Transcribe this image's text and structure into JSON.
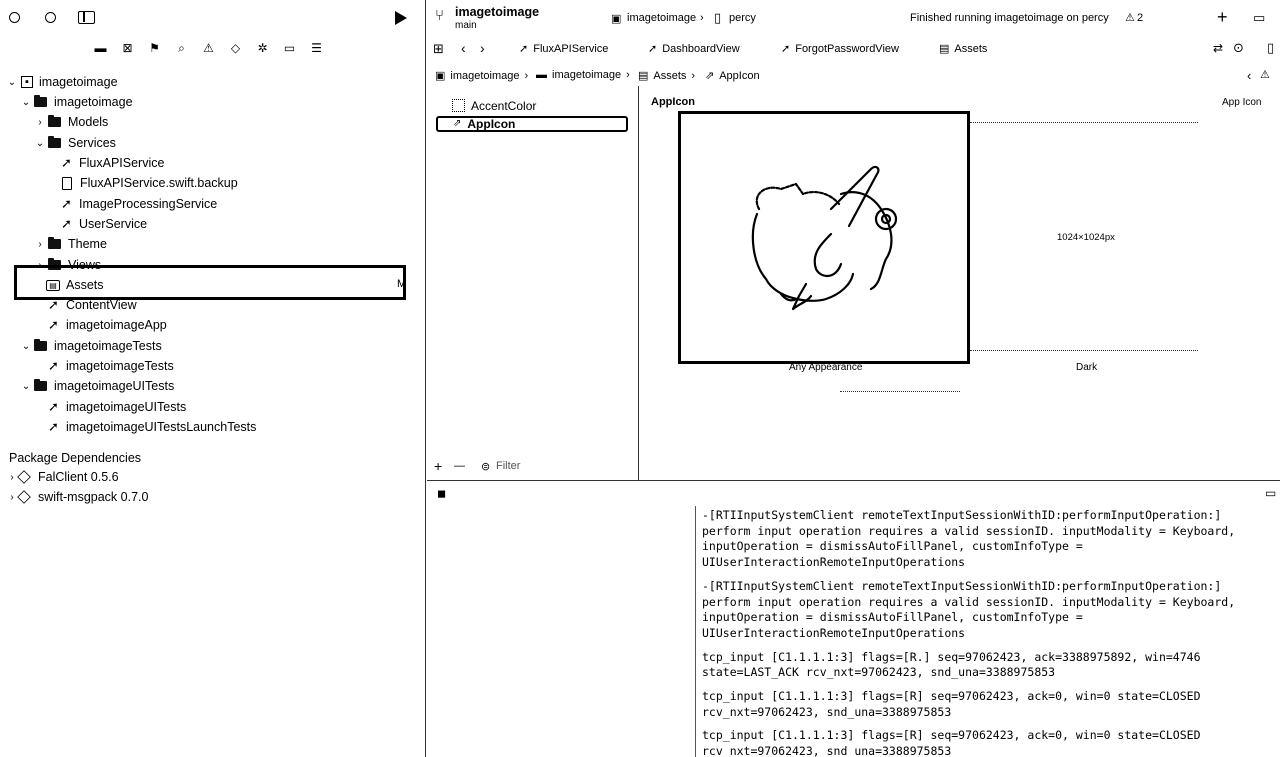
{
  "navigator": {
    "project": "imagetoimage",
    "items": [
      {
        "label": "imagetoimage",
        "kind": "folder"
      },
      {
        "label": "Models",
        "kind": "folder"
      },
      {
        "label": "Services",
        "kind": "folder"
      },
      {
        "label": "FluxAPIService",
        "kind": "swift"
      },
      {
        "label": "FluxAPIService.swift.backup",
        "kind": "file"
      },
      {
        "label": "ImageProcessingService",
        "kind": "swift"
      },
      {
        "label": "UserService",
        "kind": "swift"
      },
      {
        "label": "Theme",
        "kind": "folder"
      },
      {
        "label": "Views",
        "kind": "folder"
      },
      {
        "label": "Assets",
        "kind": "assets"
      },
      {
        "label": "ContentView",
        "kind": "swift"
      },
      {
        "label": "imagetoimageApp",
        "kind": "swift"
      },
      {
        "label": "imagetoimageTests",
        "kind": "folder"
      },
      {
        "label": "imagetoimageTests",
        "kind": "swift"
      },
      {
        "label": "imagetoimageUITests",
        "kind": "folder"
      },
      {
        "label": "imagetoimageUITests",
        "kind": "swift"
      },
      {
        "label": "imagetoimageUITestsLaunchTests",
        "kind": "swift"
      }
    ],
    "assets_badge": "M",
    "package_header": "Package Dependencies",
    "packages": [
      {
        "label": "FalClient 0.5.6"
      },
      {
        "label": "swift-msgpack 0.7.0"
      }
    ]
  },
  "toolbar": {
    "scheme_title": "imagetoimage",
    "branch": "main",
    "target": "imagetoimage",
    "device": "percy",
    "status": "Finished running imagetoimage on percy",
    "warnings": "2"
  },
  "tabs": [
    "FluxAPIService",
    "DashboardView",
    "ForgotPasswordView",
    "Assets"
  ],
  "jumpbar": [
    "imagetoimage",
    "imagetoimage",
    "Assets",
    "AppIcon"
  ],
  "asset_list": {
    "items": [
      "AccentColor",
      "AppIcon"
    ],
    "filter_placeholder": "Filter",
    "add": "+",
    "remove": "—"
  },
  "asset_detail": {
    "title": "AppIcon",
    "inspector_label": "App Icon",
    "size_label": "1024×1024px",
    "any_label": "Any Appearance",
    "dark_label": "Dark"
  },
  "console": {
    "logs": [
      "-[RTIInputSystemClient remoteTextInputSessionWithID:performInputOperation:]\nperform input operation requires a valid sessionID. inputModality = Keyboard,\ninputOperation = dismissAutoFillPanel, customInfoType =\nUIUserInteractionRemoteInputOperations",
      "-[RTIInputSystemClient remoteTextInputSessionWithID:performInputOperation:]\nperform input operation requires a valid sessionID. inputModality = Keyboard,\ninputOperation = dismissAutoFillPanel, customInfoType =\nUIUserInteractionRemoteInputOperations",
      "tcp_input [C1.1.1.1:3] flags=[R.] seq=97062423, ack=3388975892, win=4746\nstate=LAST_ACK rcv_nxt=97062423, snd_una=3388975853",
      "tcp_input [C1.1.1.1:3] flags=[R] seq=97062423, ack=0, win=0 state=CLOSED\nrcv_nxt=97062423, snd_una=3388975853",
      "tcp_input [C1.1.1.1:3] flags=[R] seq=97062423, ack=0, win=0 state=CLOSED\nrcv_nxt=97062423, snd_una=3388975853"
    ]
  }
}
